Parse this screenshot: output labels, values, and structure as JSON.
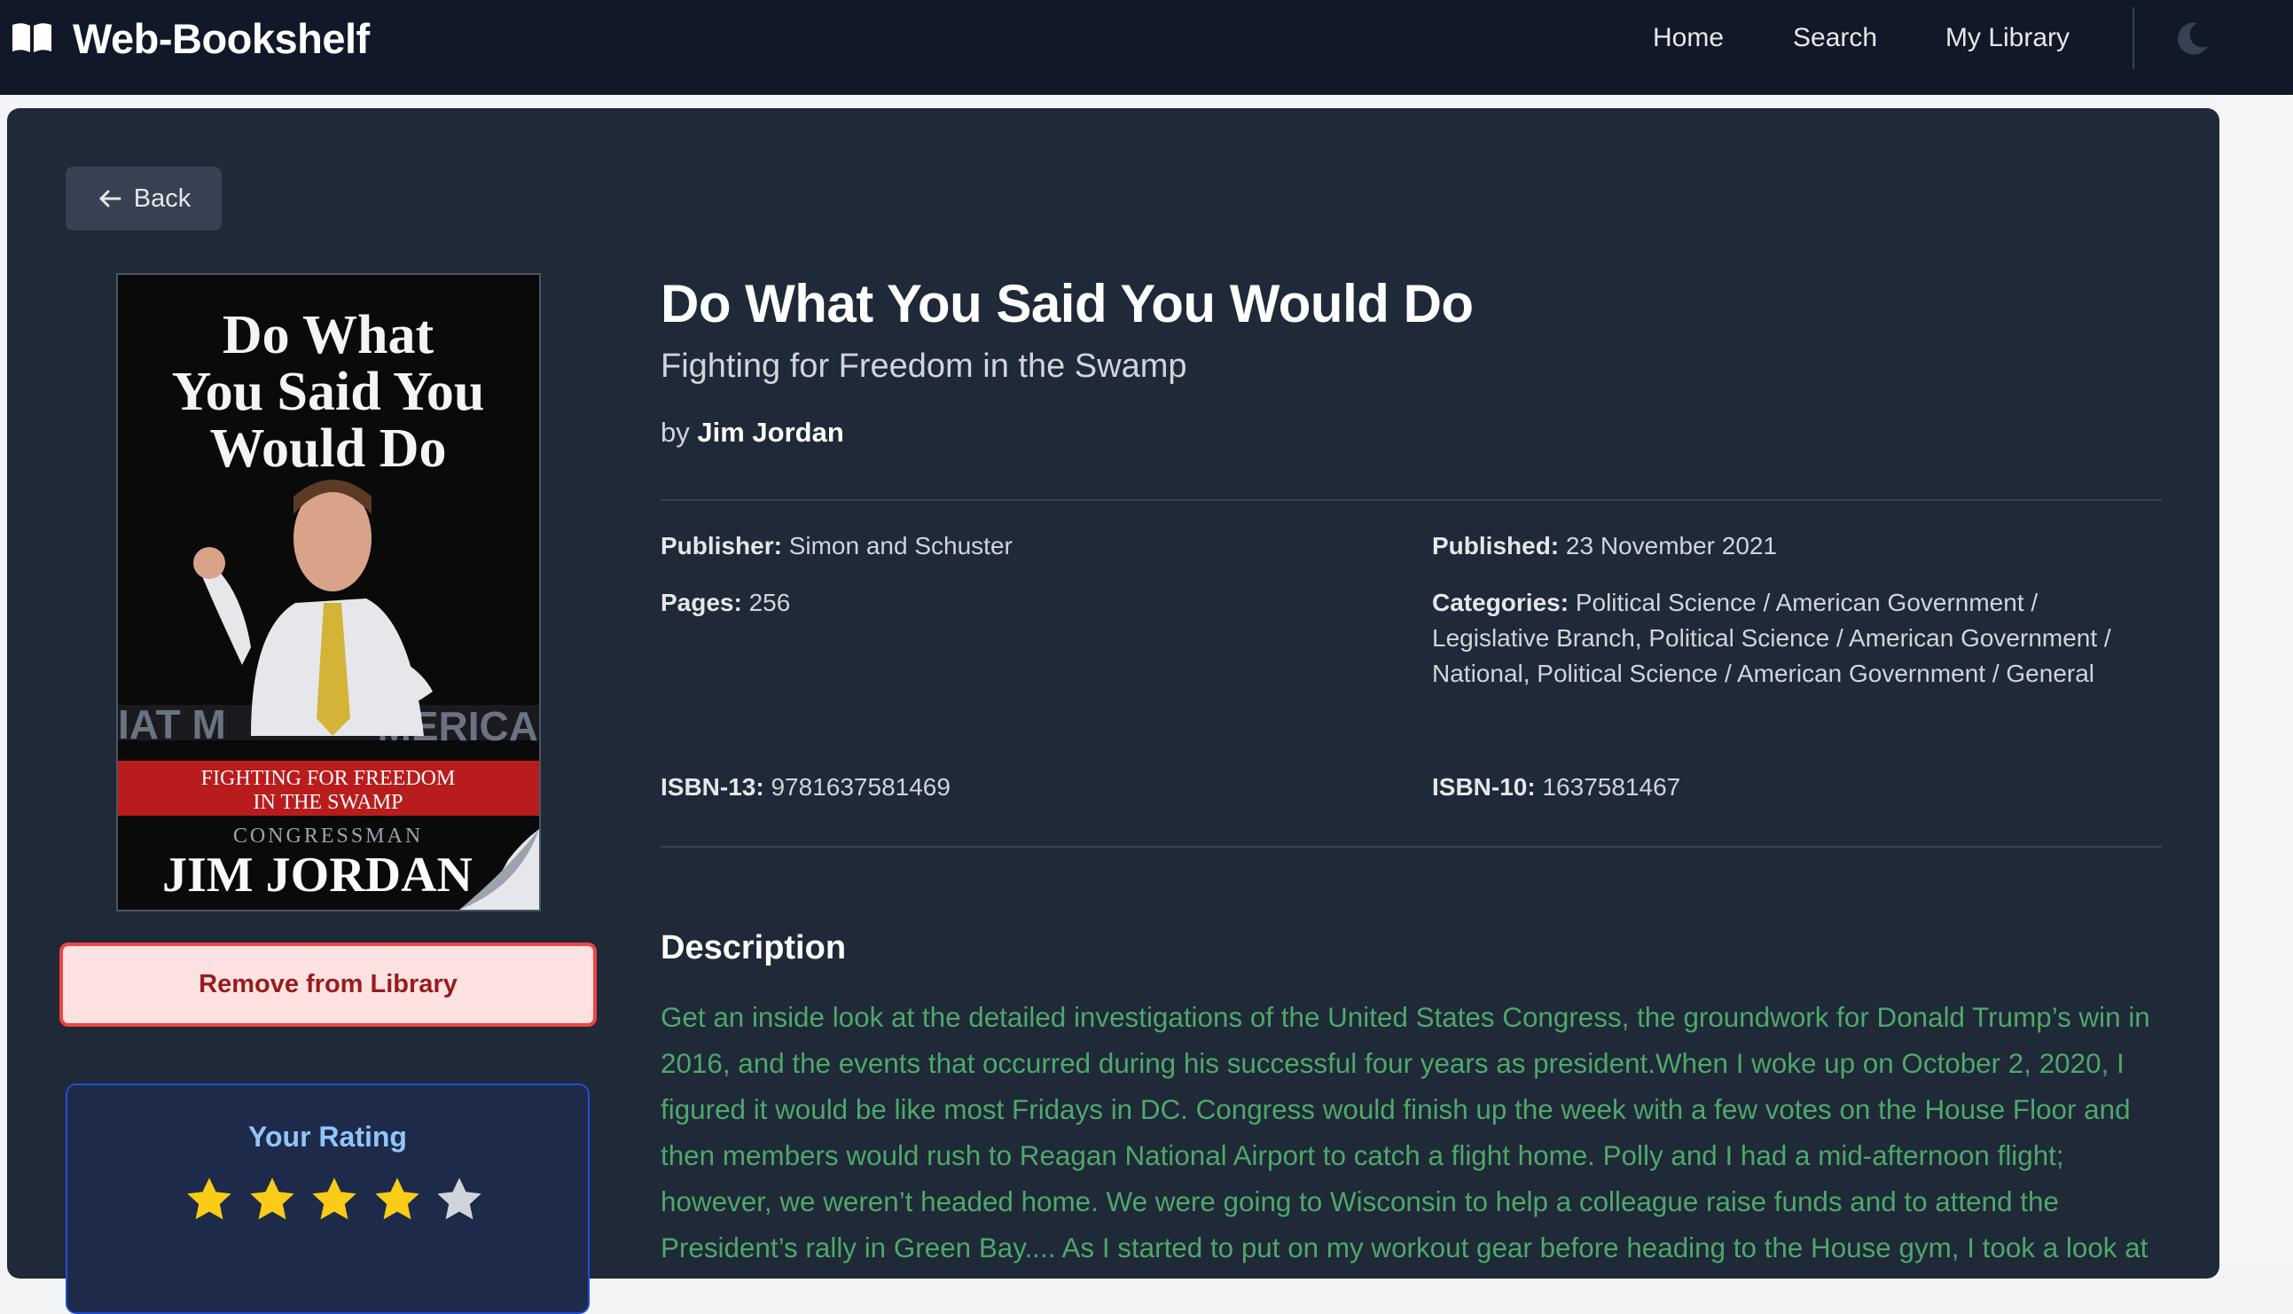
{
  "app": {
    "name": "Web-Bookshelf",
    "brand_icon": "open-book-icon"
  },
  "nav": {
    "items": [
      {
        "label": "Home"
      },
      {
        "label": "Search"
      },
      {
        "label": "My Library"
      }
    ],
    "theme_icon": "moon-icon"
  },
  "back": {
    "label": "Back",
    "icon": "arrow-left-icon"
  },
  "book": {
    "title": "Do What You Said You Would Do",
    "subtitle": "Fighting for Freedom in the Swamp",
    "by": "by",
    "author": "Jim Jordan",
    "publisher_label": "Publisher:",
    "publisher": "Simon and Schuster",
    "published_label": "Published:",
    "published": "23 November 2021",
    "pages_label": "Pages:",
    "pages": "256",
    "categories_label": "Categories:",
    "categories": "Political Science / American Government / Legislative Branch, Political Science / American Government / National, Political Science / American Government / General",
    "isbn13_label": "ISBN-13:",
    "isbn13": "9781637581469",
    "isbn10_label": "ISBN-10:",
    "isbn10": "1637581467"
  },
  "cover": {
    "title_lines": [
      "Do What",
      "You Said You",
      "Would Do"
    ],
    "banner_lines": [
      "FIGHTING FOR FREEDOM",
      "IN THE SWAMP"
    ],
    "background_word": "IAT M",
    "background_word_right": "MERICA",
    "role": "CONGRESSMAN",
    "name": "JIM JORDAN"
  },
  "library": {
    "remove_label": "Remove from Library"
  },
  "rating": {
    "title": "Your Rating",
    "value": 4,
    "max": 5
  },
  "description": {
    "heading": "Description",
    "text": "Get an inside look at the detailed investigations of the United States Congress, the groundwork for Donald Trump’s win in 2016, and the events that occurred during his successful four years as president.When I woke up on October 2, 2020, I figured it would be like most Fridays in DC. Congress would finish up the week with a few votes on the House Floor and then members would rush to Reagan National Airport to catch a flight home. Polly and I had a mid-afternoon flight; however, we weren’t headed home. We were going to Wisconsin to help a colleague raise funds and to attend the President’s rally in Green Bay.... As I started to put on my workout gear before heading to the House gym, I took a look at my phone. I noticed I had several text messages and missed phone calls from Russell Dye, the top media staffer for our personal office and for Republicans on the House Judiciary Committee. Some of the calls"
  },
  "colors": {
    "navbar": "#111827",
    "card": "#1f2937",
    "description_text": "#4ea86a",
    "remove_border": "#ef4444",
    "star_filled": "#facc15",
    "star_empty": "#d1d5db"
  }
}
